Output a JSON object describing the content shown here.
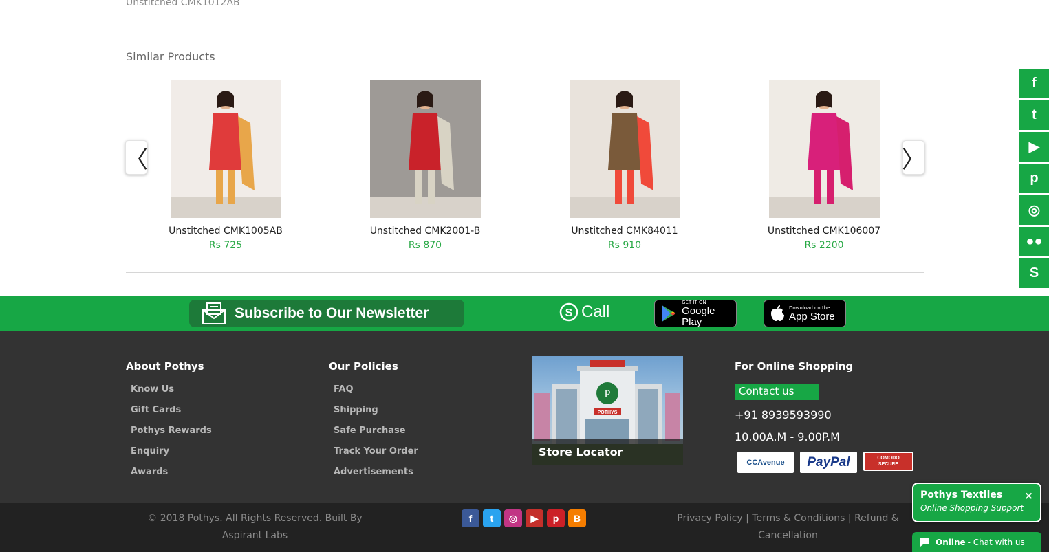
{
  "top": {
    "previous_item": "Unstitched CMK1012AB"
  },
  "similar": {
    "title": "Similar Products",
    "prev_glyph": "〈",
    "next_glyph": "〉",
    "products": [
      {
        "name": "Unstitched CMK1005AB",
        "price": "Rs 725",
        "dress_color": "#e03b3b",
        "dupatta_color": "#e8a64a",
        "bg_color": "#f1ece8"
      },
      {
        "name": "Unstitched CMK2001-B",
        "price": "Rs 870",
        "dress_color": "#c9222a",
        "dupatta_color": "#d8d3c4",
        "bg_color": "#9e9a96"
      },
      {
        "name": "Unstitched CMK84011",
        "price": "Rs 910",
        "dress_color": "#7a5a3a",
        "dupatta_color": "#f04a3a",
        "bg_color": "#e9e3dc"
      },
      {
        "name": "Unstitched CMK106007",
        "price": "Rs 2200",
        "dress_color": "#d8207a",
        "dupatta_color": "#d61f6e",
        "bg_color": "#efebe5"
      }
    ]
  },
  "band": {
    "newsletter_label": "Subscribe to Our Newsletter",
    "call_label": "Call",
    "google_play": {
      "small": "GET IT ON",
      "big": "Google Play"
    },
    "app_store": {
      "small": "Download on the",
      "big": "App Store"
    }
  },
  "footer": {
    "about": {
      "title": "About Pothys",
      "items": [
        "Know Us",
        "Gift Cards",
        "Pothys Rewards",
        "Enquiry",
        "Awards"
      ]
    },
    "policies": {
      "title": "Our Policies",
      "items": [
        "FAQ",
        "Shipping",
        "Safe Purchase",
        "Track Your Order",
        "Advertisements"
      ]
    },
    "store_locator": {
      "label": "Store Locator",
      "sign": "POTHYS"
    },
    "online": {
      "title": "For Online Shopping",
      "contact_label": "Contact us",
      "phone": "+91 8939593990",
      "hours": "10.00A.M - 9.00P.M",
      "badges": [
        "CCAvenue",
        "PayPal",
        "COMODO SECURE"
      ]
    }
  },
  "bottom": {
    "copyright": "© 2018 Pothys. All Rights Reserved. Built By Aspirant Labs",
    "legal": "Privacy Policy | Terms & Conditions | Refund & Cancellation",
    "social": [
      {
        "name": "facebook",
        "glyph": "f",
        "color": "#3b5998"
      },
      {
        "name": "twitter",
        "glyph": "t",
        "color": "#2aa3ef"
      },
      {
        "name": "instagram",
        "glyph": "◎",
        "color": "#c13584"
      },
      {
        "name": "youtube",
        "glyph": "▶",
        "color": "#c4302b"
      },
      {
        "name": "pinterest",
        "glyph": "p",
        "color": "#cb2027"
      },
      {
        "name": "blogger",
        "glyph": "B",
        "color": "#f57d00"
      }
    ]
  },
  "side_social": [
    {
      "name": "facebook",
      "glyph": "f"
    },
    {
      "name": "twitter",
      "glyph": "t"
    },
    {
      "name": "youtube",
      "glyph": "▶"
    },
    {
      "name": "pinterest",
      "glyph": "p"
    },
    {
      "name": "instagram",
      "glyph": "◎"
    },
    {
      "name": "flickr",
      "glyph": "●●"
    },
    {
      "name": "skype",
      "glyph": "S"
    }
  ],
  "chat": {
    "title": "Pothys Textiles",
    "subtitle": "Online Shopping Support",
    "close": "×",
    "status": "Online",
    "action": "- Chat with us"
  }
}
